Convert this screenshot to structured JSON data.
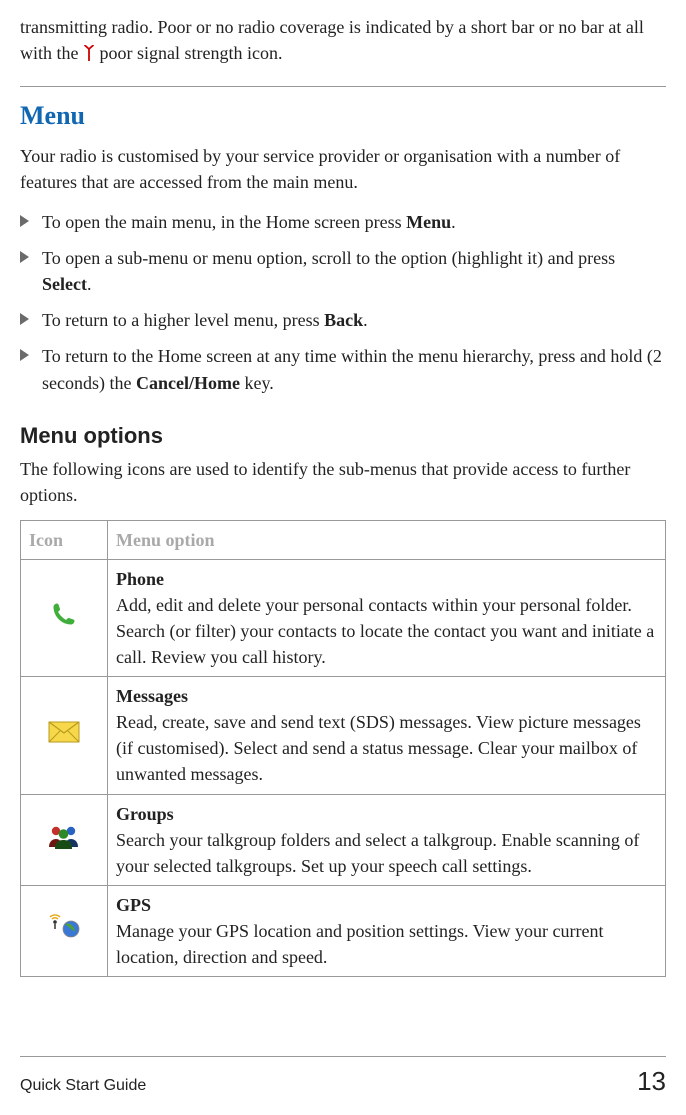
{
  "intro": {
    "part1": "transmitting radio. Poor or no radio coverage is indicated by a short bar or no bar at all with the ",
    "part2": " poor signal strength icon."
  },
  "menu": {
    "heading": "Menu",
    "desc": "Your radio is customised by your service provider or organisation with a number of features that are accessed from the main menu.",
    "list": {
      "i0a": "To open the main menu, in the Home screen press ",
      "i0b": "Menu",
      "i0c": ".",
      "i1a": "To open a sub-menu or menu option, scroll to the option (highlight it) and press ",
      "i1b": "Select",
      "i1c": ".",
      "i2a": "To return to a higher level menu, press ",
      "i2b": "Back",
      "i2c": ".",
      "i3a": "To return to the Home screen at any time within the menu hierarchy, press and hold (2 seconds) the ",
      "i3b": "Cancel/Home",
      "i3c": " key."
    }
  },
  "options": {
    "heading": "Menu options",
    "desc": "The following icons are used to identify the sub-menus that provide access to further options.",
    "table": {
      "h_icon": "Icon",
      "h_opt": "Menu option",
      "rows": [
        {
          "title": "Phone",
          "desc": "Add, edit and delete your personal contacts within your personal folder. Search (or filter) your contacts to locate the contact you want and initiate a call. Review you call history."
        },
        {
          "title": "Messages",
          "desc": "Read, create, save and send text (SDS) messages. View picture messages (if customised). Select and send a status message. Clear your mailbox of unwanted messages."
        },
        {
          "title": "Groups",
          "desc": "Search your talkgroup folders and select a talkgroup. Enable scanning of your selected talkgroups. Set up your speech call settings."
        },
        {
          "title": "GPS",
          "desc": "Manage your GPS location and position settings. View your current location, direction and speed."
        }
      ]
    }
  },
  "footer": {
    "title": "Quick Start Guide",
    "page": "13"
  }
}
